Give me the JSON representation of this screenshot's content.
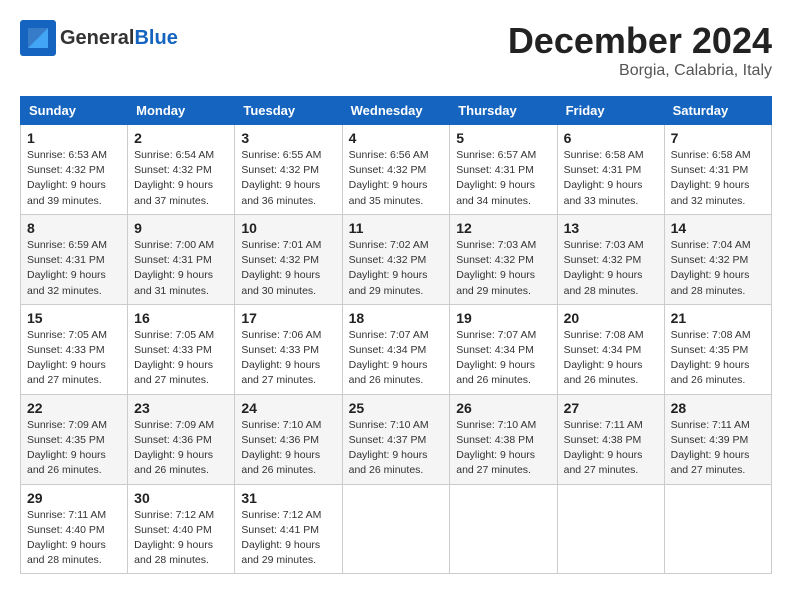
{
  "header": {
    "logo_general": "General",
    "logo_blue": "Blue",
    "month_title": "December 2024",
    "location": "Borgia, Calabria, Italy"
  },
  "days_of_week": [
    "Sunday",
    "Monday",
    "Tuesday",
    "Wednesday",
    "Thursday",
    "Friday",
    "Saturday"
  ],
  "weeks": [
    [
      {
        "day": "1",
        "sunrise": "6:53 AM",
        "sunset": "4:32 PM",
        "daylight": "9 hours and 39 minutes."
      },
      {
        "day": "2",
        "sunrise": "6:54 AM",
        "sunset": "4:32 PM",
        "daylight": "9 hours and 37 minutes."
      },
      {
        "day": "3",
        "sunrise": "6:55 AM",
        "sunset": "4:32 PM",
        "daylight": "9 hours and 36 minutes."
      },
      {
        "day": "4",
        "sunrise": "6:56 AM",
        "sunset": "4:32 PM",
        "daylight": "9 hours and 35 minutes."
      },
      {
        "day": "5",
        "sunrise": "6:57 AM",
        "sunset": "4:31 PM",
        "daylight": "9 hours and 34 minutes."
      },
      {
        "day": "6",
        "sunrise": "6:58 AM",
        "sunset": "4:31 PM",
        "daylight": "9 hours and 33 minutes."
      },
      {
        "day": "7",
        "sunrise": "6:58 AM",
        "sunset": "4:31 PM",
        "daylight": "9 hours and 32 minutes."
      }
    ],
    [
      {
        "day": "8",
        "sunrise": "6:59 AM",
        "sunset": "4:31 PM",
        "daylight": "9 hours and 32 minutes."
      },
      {
        "day": "9",
        "sunrise": "7:00 AM",
        "sunset": "4:31 PM",
        "daylight": "9 hours and 31 minutes."
      },
      {
        "day": "10",
        "sunrise": "7:01 AM",
        "sunset": "4:32 PM",
        "daylight": "9 hours and 30 minutes."
      },
      {
        "day": "11",
        "sunrise": "7:02 AM",
        "sunset": "4:32 PM",
        "daylight": "9 hours and 29 minutes."
      },
      {
        "day": "12",
        "sunrise": "7:03 AM",
        "sunset": "4:32 PM",
        "daylight": "9 hours and 29 minutes."
      },
      {
        "day": "13",
        "sunrise": "7:03 AM",
        "sunset": "4:32 PM",
        "daylight": "9 hours and 28 minutes."
      },
      {
        "day": "14",
        "sunrise": "7:04 AM",
        "sunset": "4:32 PM",
        "daylight": "9 hours and 28 minutes."
      }
    ],
    [
      {
        "day": "15",
        "sunrise": "7:05 AM",
        "sunset": "4:33 PM",
        "daylight": "9 hours and 27 minutes."
      },
      {
        "day": "16",
        "sunrise": "7:05 AM",
        "sunset": "4:33 PM",
        "daylight": "9 hours and 27 minutes."
      },
      {
        "day": "17",
        "sunrise": "7:06 AM",
        "sunset": "4:33 PM",
        "daylight": "9 hours and 27 minutes."
      },
      {
        "day": "18",
        "sunrise": "7:07 AM",
        "sunset": "4:34 PM",
        "daylight": "9 hours and 26 minutes."
      },
      {
        "day": "19",
        "sunrise": "7:07 AM",
        "sunset": "4:34 PM",
        "daylight": "9 hours and 26 minutes."
      },
      {
        "day": "20",
        "sunrise": "7:08 AM",
        "sunset": "4:34 PM",
        "daylight": "9 hours and 26 minutes."
      },
      {
        "day": "21",
        "sunrise": "7:08 AM",
        "sunset": "4:35 PM",
        "daylight": "9 hours and 26 minutes."
      }
    ],
    [
      {
        "day": "22",
        "sunrise": "7:09 AM",
        "sunset": "4:35 PM",
        "daylight": "9 hours and 26 minutes."
      },
      {
        "day": "23",
        "sunrise": "7:09 AM",
        "sunset": "4:36 PM",
        "daylight": "9 hours and 26 minutes."
      },
      {
        "day": "24",
        "sunrise": "7:10 AM",
        "sunset": "4:36 PM",
        "daylight": "9 hours and 26 minutes."
      },
      {
        "day": "25",
        "sunrise": "7:10 AM",
        "sunset": "4:37 PM",
        "daylight": "9 hours and 26 minutes."
      },
      {
        "day": "26",
        "sunrise": "7:10 AM",
        "sunset": "4:38 PM",
        "daylight": "9 hours and 27 minutes."
      },
      {
        "day": "27",
        "sunrise": "7:11 AM",
        "sunset": "4:38 PM",
        "daylight": "9 hours and 27 minutes."
      },
      {
        "day": "28",
        "sunrise": "7:11 AM",
        "sunset": "4:39 PM",
        "daylight": "9 hours and 27 minutes."
      }
    ],
    [
      {
        "day": "29",
        "sunrise": "7:11 AM",
        "sunset": "4:40 PM",
        "daylight": "9 hours and 28 minutes."
      },
      {
        "day": "30",
        "sunrise": "7:12 AM",
        "sunset": "4:40 PM",
        "daylight": "9 hours and 28 minutes."
      },
      {
        "day": "31",
        "sunrise": "7:12 AM",
        "sunset": "4:41 PM",
        "daylight": "9 hours and 29 minutes."
      },
      null,
      null,
      null,
      null
    ]
  ]
}
